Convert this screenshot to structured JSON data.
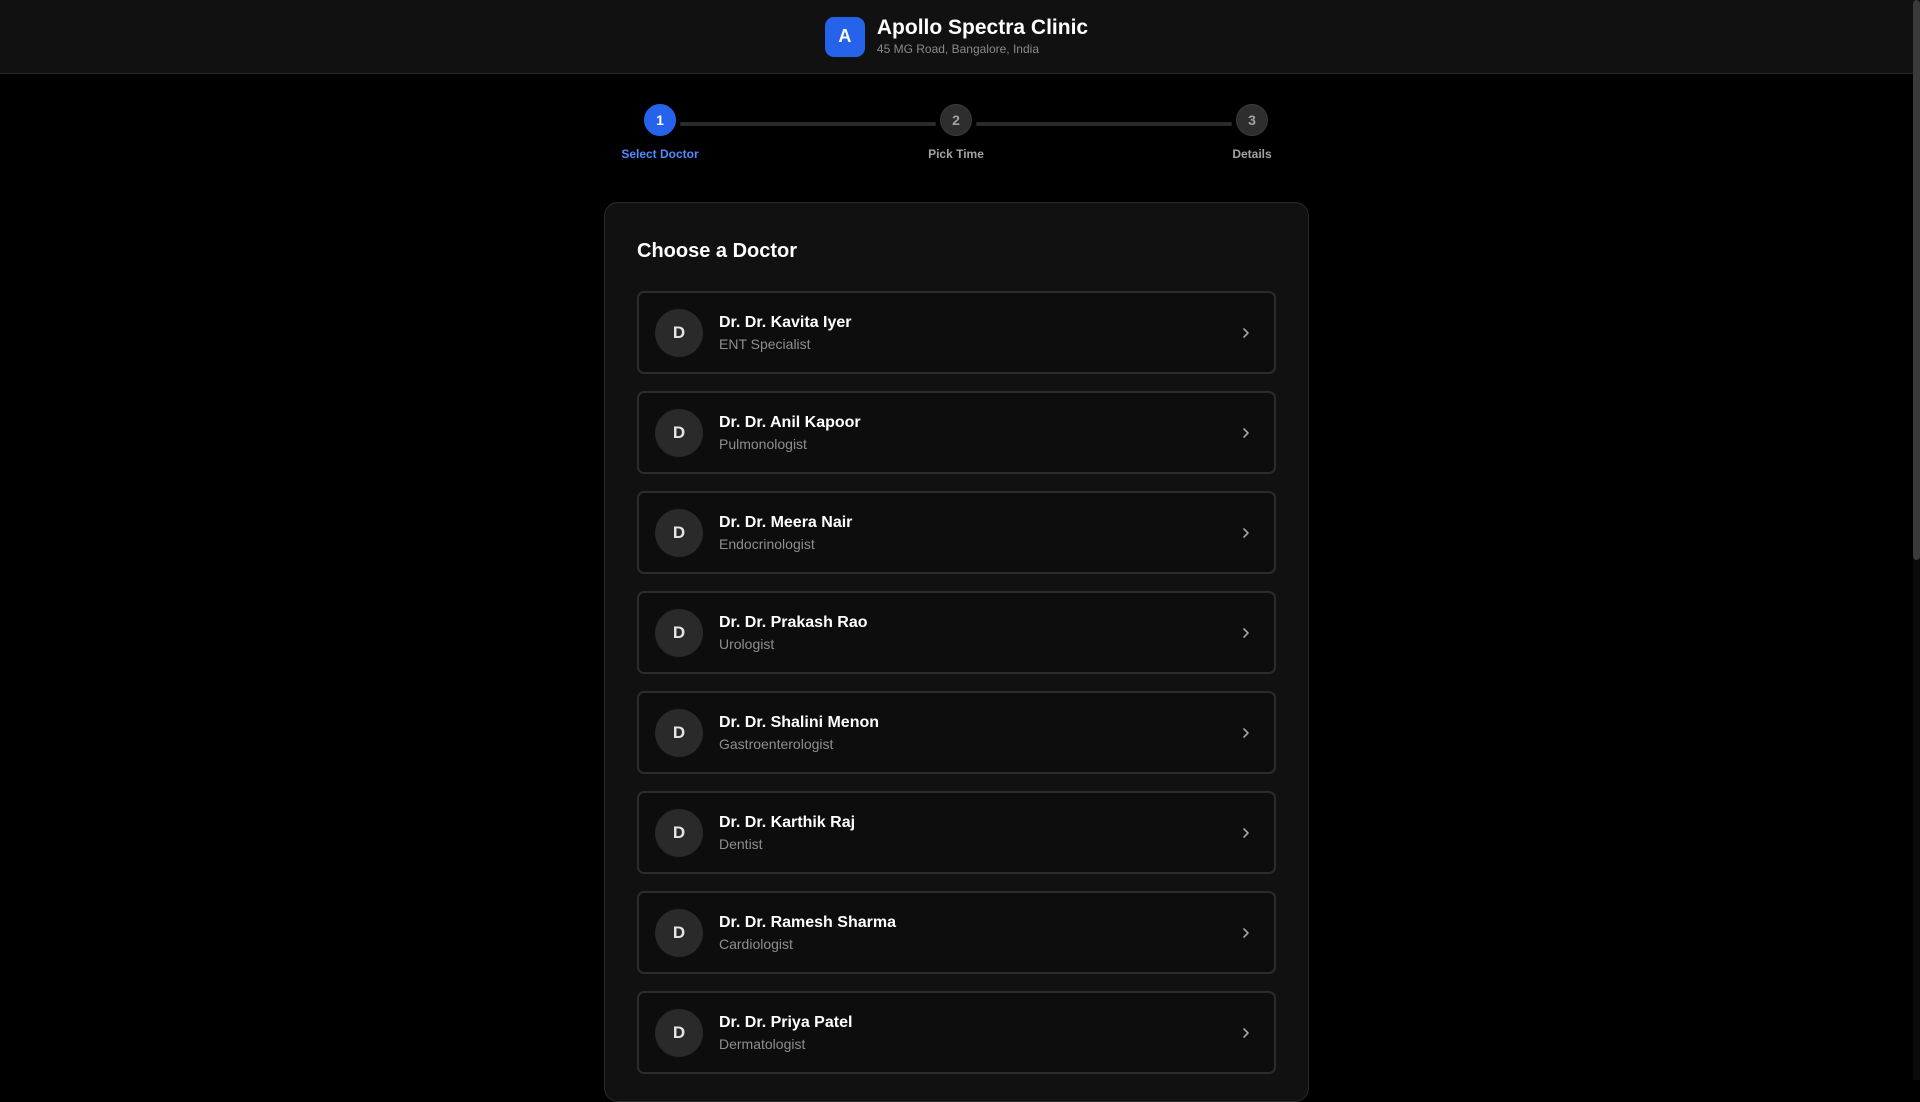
{
  "header": {
    "logo_letter": "A",
    "clinic_name": "Apollo Spectra Clinic",
    "address": "45 MG Road, Bangalore, India"
  },
  "stepper": {
    "steps": [
      {
        "number": "1",
        "label": "Select Doctor",
        "active": true
      },
      {
        "number": "2",
        "label": "Pick Time",
        "active": false
      },
      {
        "number": "3",
        "label": "Details",
        "active": false
      }
    ]
  },
  "main": {
    "title": "Choose a Doctor",
    "doctors": [
      {
        "initial": "D",
        "name": "Dr. Dr. Kavita Iyer",
        "specialty": "ENT Specialist"
      },
      {
        "initial": "D",
        "name": "Dr. Dr. Anil Kapoor",
        "specialty": "Pulmonologist"
      },
      {
        "initial": "D",
        "name": "Dr. Dr. Meera Nair",
        "specialty": "Endocrinologist"
      },
      {
        "initial": "D",
        "name": "Dr. Dr. Prakash Rao",
        "specialty": "Urologist"
      },
      {
        "initial": "D",
        "name": "Dr. Dr. Shalini Menon",
        "specialty": "Gastroenterologist"
      },
      {
        "initial": "D",
        "name": "Dr. Dr. Karthik Raj",
        "specialty": "Dentist"
      },
      {
        "initial": "D",
        "name": "Dr. Dr. Ramesh Sharma",
        "specialty": "Cardiologist"
      },
      {
        "initial": "D",
        "name": "Dr. Dr. Priya Patel",
        "specialty": "Dermatologist"
      }
    ]
  },
  "icons": {
    "row_action": "chevron-right-icon"
  },
  "colors": {
    "accent": "#2563eb",
    "accent_text": "#4f8cff",
    "background": "#000000",
    "surface": "#111111"
  }
}
